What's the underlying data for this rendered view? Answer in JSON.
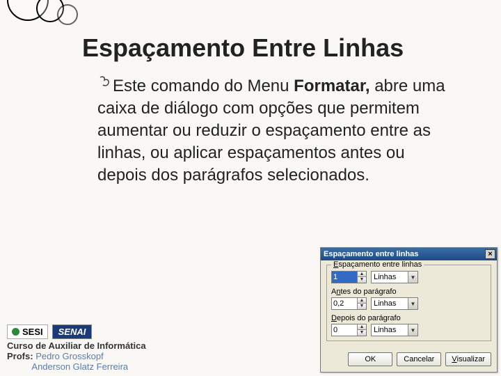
{
  "slide": {
    "title": "Espaçamento Entre Linhas",
    "body_prefix": "Este comando do Menu ",
    "body_bold": "Formatar,",
    "body_rest": " abre uma caixa de diálogo com opções que permitem aumentar ou reduzir o espaçamento entre as linhas, ou aplicar espaçamentos antes ou depois dos parágrafos selecionados."
  },
  "footer": {
    "logo1": "SESI",
    "logo2": "SENAI",
    "course": "Curso de Auxiliar de Informática",
    "profs_label": "Profs:",
    "prof1": "Pedro Grosskopf",
    "prof2": "Anderson Glatz Ferreira"
  },
  "dialog": {
    "title": "Espaçamento entre linhas",
    "group_legend": "Espaçamento entre linhas",
    "spin1_value": "1",
    "unit_label": "Linhas",
    "before_label_pre": "A",
    "before_label_un": "n",
    "before_label_post": "tes do parágrafo",
    "spin2_value": "0,2",
    "after_label_pre": "",
    "after_label_un": "D",
    "after_label_post": "epois do parágrafo",
    "spin3_value": "0",
    "btn_ok": "OK",
    "btn_cancel": "Cancelar",
    "btn_preview_un": "V",
    "btn_preview_rest": "isualizar"
  }
}
